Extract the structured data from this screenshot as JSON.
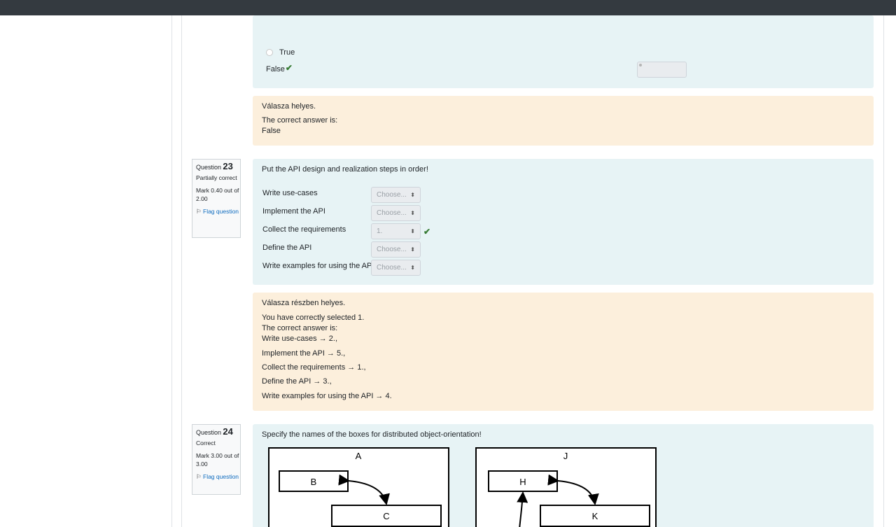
{
  "q22": {
    "options": [
      {
        "label": "True",
        "selected": false,
        "correct": false
      },
      {
        "label": "False",
        "selected": true,
        "correct": true
      }
    ],
    "feedback": {
      "status": "Válasza helyes.",
      "correct_answer_heading": "The correct answer is:",
      "correct_answer": "False"
    }
  },
  "q23": {
    "info": {
      "prefix": "Question",
      "number": "23",
      "state": "Partially correct",
      "mark": "Mark 0.40 out of 2.00",
      "flag": "Flag question"
    },
    "text": "Put the API design and realization steps in order!",
    "rows": [
      {
        "label": "Write use-cases",
        "value": "Choose..."
      },
      {
        "label": "Implement the API",
        "value": "Choose..."
      },
      {
        "label": "Collect the requirements",
        "value": "1."
      },
      {
        "label": "Define the API",
        "value": "Choose..."
      },
      {
        "label": "Write examples for using the API",
        "value": "Choose..."
      }
    ],
    "feedback": {
      "status": "Válasza részben helyes.",
      "selected_note": "You have correctly selected 1.",
      "correct_answer_heading": "The correct answer is:",
      "lines": [
        "Write use-cases → 2.,",
        "Implement the API → 5.,",
        "Collect the requirements → 1.,",
        "Define the API → 3.,",
        "Write examples for using the API → 4."
      ]
    }
  },
  "q24": {
    "info": {
      "prefix": "Question",
      "number": "24",
      "state": "Correct",
      "mark": "Mark 3.00 out of 3.00",
      "flag": "Flag question"
    },
    "text": "Specify the names of the boxes for distributed object-orientation!",
    "diagram_labels": {
      "left_outer": "A",
      "left_b": "B",
      "left_c": "C",
      "right_outer": "J",
      "right_h": "H",
      "right_k": "K"
    }
  },
  "colors": {
    "topbar": "#343a40",
    "question_bg": "#e7f3f5",
    "feedback_bg": "#fcefdc",
    "feedback_text": "#8e662e",
    "check": "#357a32",
    "link": "#0f6cbf"
  }
}
